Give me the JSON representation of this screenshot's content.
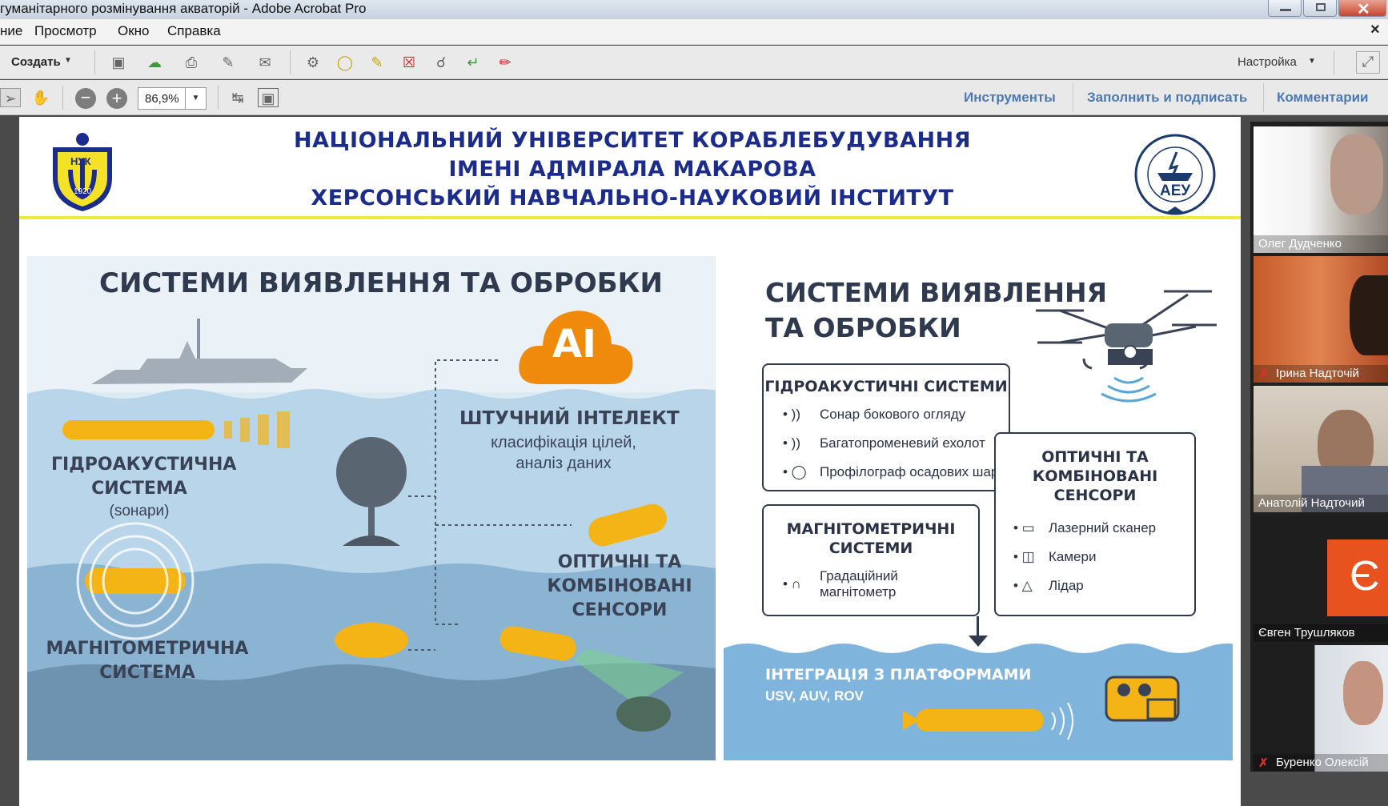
{
  "window": {
    "title": "гуманітарного розмінування акваторій - Adobe Acrobat Pro",
    "close_label": "×"
  },
  "menu": {
    "items": [
      "ние",
      "Просмотр",
      "Окно",
      "Справка"
    ]
  },
  "toolbar": {
    "create_label": "Создать",
    "customize_label": "Настройка",
    "zoom_value": "86,9%"
  },
  "right_tabs": [
    "Инструменты",
    "Заполнить и подписать",
    "Комментарии"
  ],
  "slide": {
    "header_lines": [
      "НАЦІОНАЛЬНИЙ УНІВЕРСИТЕТ КОРАБЛЕБУДУВАННЯ",
      "ІМЕНІ АДМІРАЛА МАКАРОВА",
      "ХЕРСОНСЬКИЙ НАВЧАЛЬНО-НАУКОВИЙ ІНСТИТУТ"
    ],
    "logo_left_text": "НУК",
    "logo_left_year": "1920",
    "logo_right_text": "АЕУ",
    "left": {
      "heading": "СИСТЕМИ ВИЯВЛЕННЯ ТА ОБРОБКИ",
      "ai_badge": "AI",
      "ai_title": "ШТУЧНИЙ ІНТЕЛЕКТ",
      "ai_sub1": "класифікація цілей,",
      "ai_sub2": "аналіз даних",
      "hydro_line1": "ГІДРОАКУСТИЧНА",
      "hydro_line2": "СИСТЕМА",
      "hydro_sub": "(sонари)",
      "optic_line1": "ОПТИЧНІ ТА",
      "optic_line2": "КОМБІНОВАНІ",
      "optic_line3": "СЕНСОРИ",
      "magnet_line1": "МАГНІТОМЕТРИЧНА",
      "magnet_line2": "СИСТЕМА"
    },
    "right": {
      "heading_line1": "СИСТЕМИ ВИЯВЛЕННЯ",
      "heading_line2": "ТА ОБРОБКИ",
      "hydro_box": {
        "title": "ГІДРОАКУСТИЧНІ СИСТЕМИ",
        "items": [
          "Сонар бокового огляду",
          "Багатопроменевий ехолот",
          "Профілограф осадових шарів"
        ]
      },
      "optic_box": {
        "title_line1": "ОПТИЧНІ ТА",
        "title_line2": "КОМБІНОВАНІ",
        "title_line3": "СЕНСОРИ",
        "items": [
          "Лазерний сканер",
          "Камери",
          "Лідар"
        ]
      },
      "magnet_box": {
        "title_line1": "МАГНІТОМЕТРИЧНІ",
        "title_line2": "СИСТЕМИ",
        "item_line1": "Градаційний",
        "item_line2": "магнітометр"
      },
      "integration_title": "ІНТЕГРАЦІЯ З ПЛАТФОРМАМИ",
      "integration_sub": "USV, AUV, ROV"
    }
  },
  "participants": [
    {
      "name": "Олег Дудченко",
      "muted": false
    },
    {
      "name": "Ірина Надточій",
      "muted": true
    },
    {
      "name": "Анатолій Надточий",
      "muted": false
    },
    {
      "name": "Євген Трушляков",
      "muted": false,
      "avatar_letter": "Є"
    },
    {
      "name": "Буренко Олексій",
      "muted": true
    }
  ],
  "colors": {
    "header_blue": "#1c2c8c",
    "accent_yellow": "#f5b416",
    "ai_orange": "#f08a0c",
    "tab_blue": "#4a79b3",
    "avatar_orange": "#e8521e"
  }
}
